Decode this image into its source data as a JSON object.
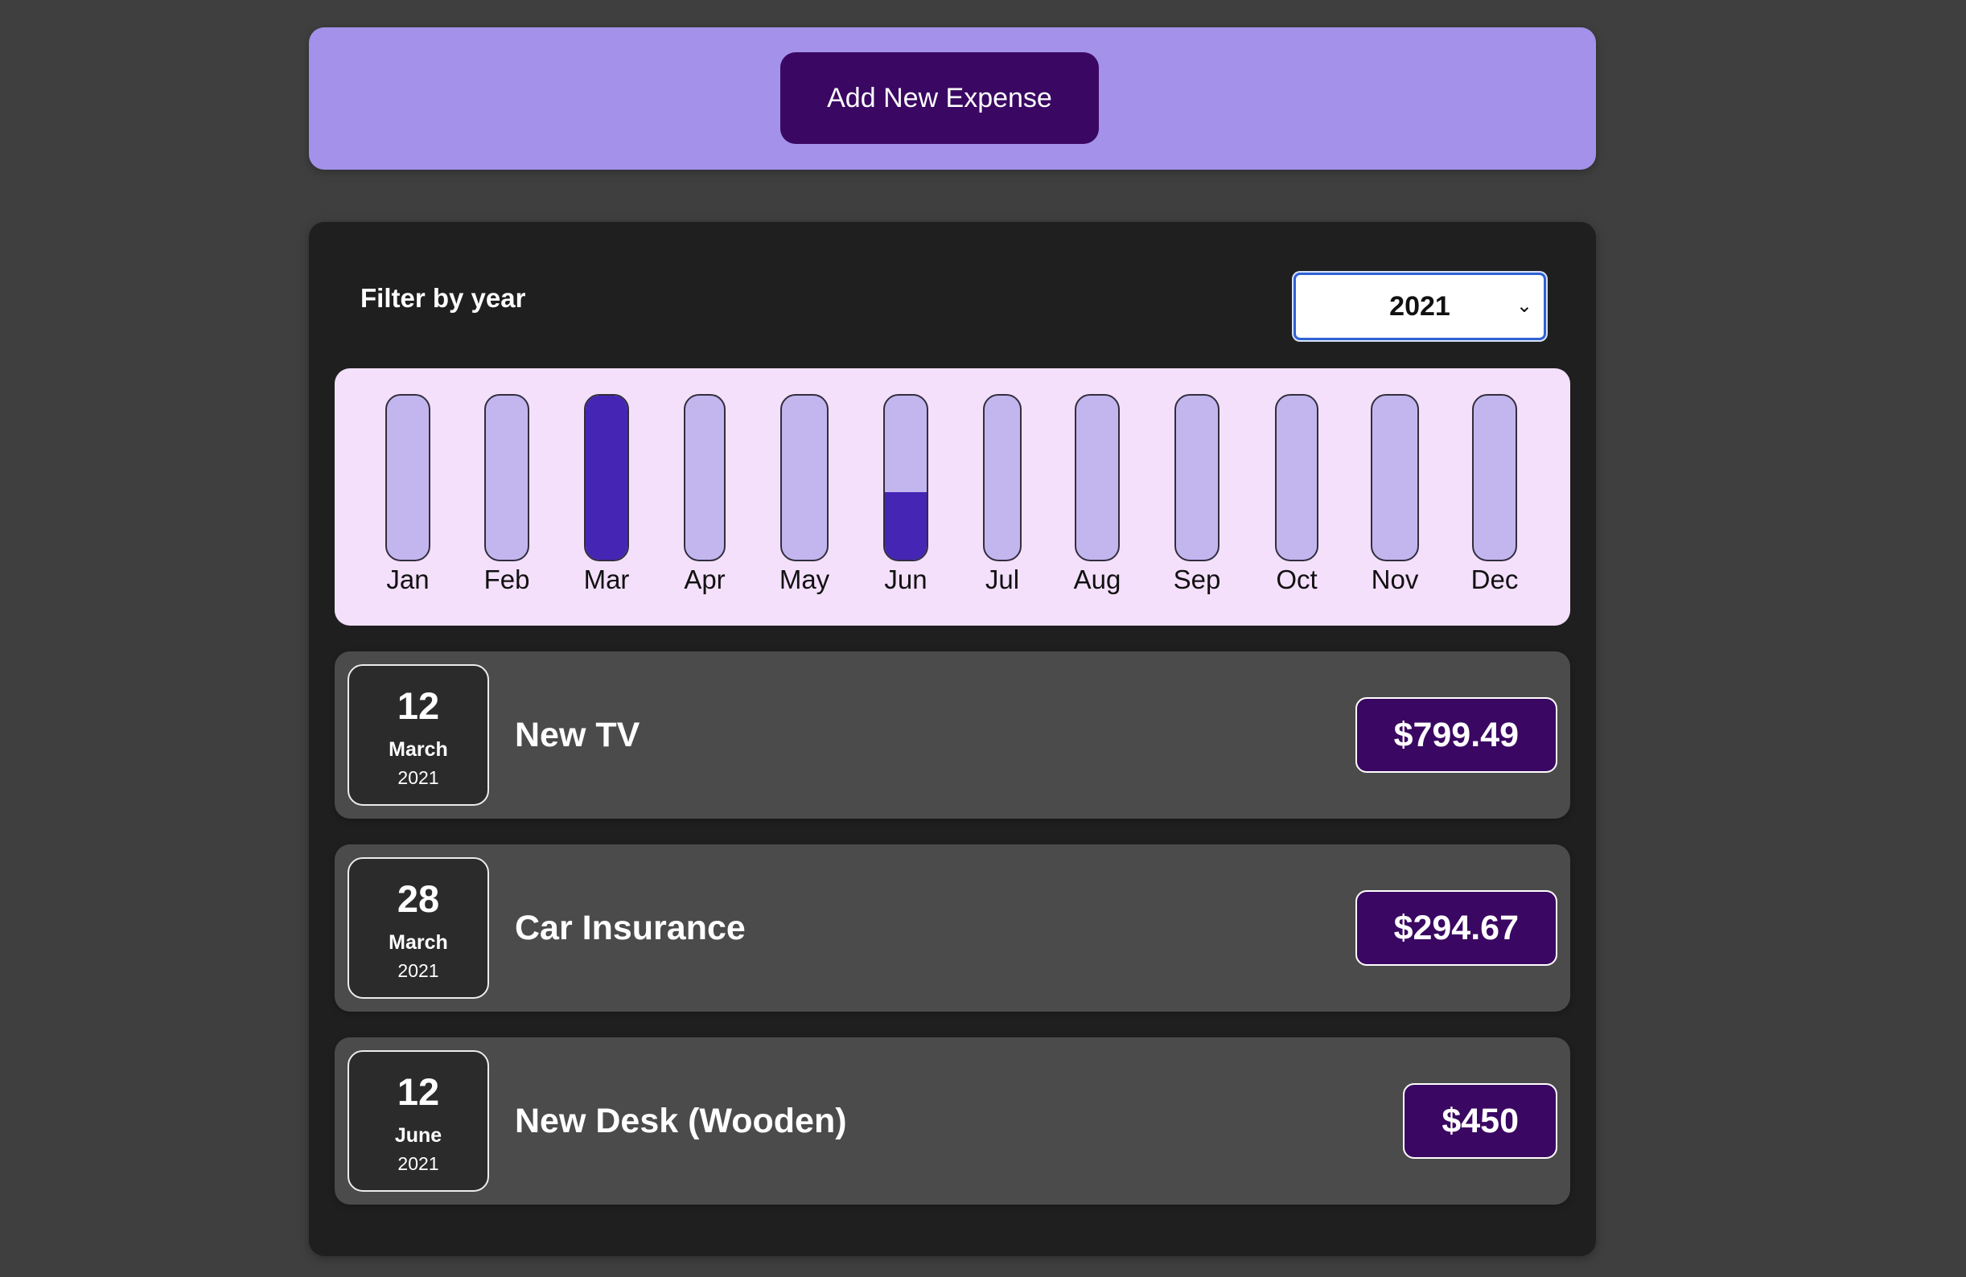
{
  "new_expense": {
    "button_label": "Add New Expense"
  },
  "filter": {
    "label": "Filter by year",
    "selected_year": "2021"
  },
  "chart_data": {
    "type": "bar",
    "categories": [
      "Jan",
      "Feb",
      "Mar",
      "Apr",
      "May",
      "Jun",
      "Jul",
      "Aug",
      "Sep",
      "Oct",
      "Nov",
      "Dec"
    ],
    "values": [
      0,
      0,
      1094.16,
      0,
      0,
      450,
      0,
      0,
      0,
      0,
      0,
      0
    ],
    "ylim": [
      0,
      1094.16
    ]
  },
  "expenses": [
    {
      "day": "12",
      "month": "March",
      "year": "2021",
      "title": "New TV",
      "amount": "$799.49"
    },
    {
      "day": "28",
      "month": "March",
      "year": "2021",
      "title": "Car Insurance",
      "amount": "$294.67"
    },
    {
      "day": "12",
      "month": "June",
      "year": "2021",
      "title": "New Desk (Wooden)",
      "amount": "$450"
    }
  ],
  "colors": {
    "page_background": "#3f3f3f",
    "new_expense_background": "#a391ea",
    "button_background": "#3a0862",
    "panel_background": "#1f1f1f",
    "chart_background": "#f4e0fb",
    "bar_empty": "#c3b6ef",
    "bar_fill": "#4526b4",
    "item_background": "#4b4b4b"
  }
}
